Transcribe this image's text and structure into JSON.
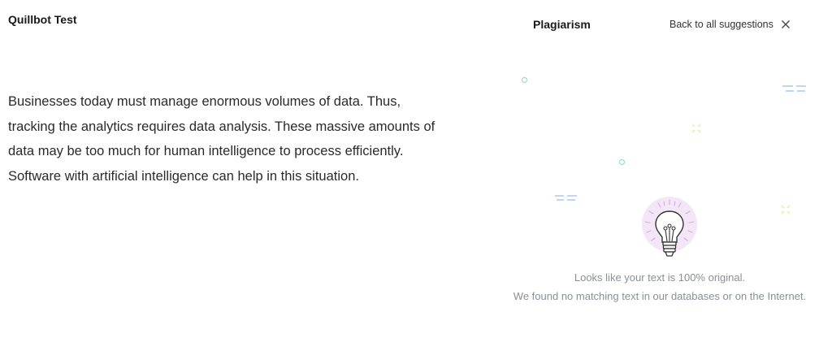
{
  "document": {
    "title": "Quillbot Test",
    "lines": [
      "Businesses today must manage enormous volumes of data. Thus,",
      "tracking the analytics requires data analysis. These massive amounts of",
      "data may be too much for human intelligence to process efficiently.",
      "Software with artificial intelligence can help in this situation."
    ]
  },
  "panel": {
    "title": "Plagiarism",
    "back_label": "Back to all suggestions",
    "close_icon": "close-icon",
    "result_icon": "lightbulb-icon",
    "message_primary": "Looks like your text is 100% original.",
    "message_secondary": "We found no matching text in our databases or on the Internet."
  },
  "colors": {
    "accent_teal": "#8fd3c8",
    "accent_blue": "#a9c8ee",
    "accent_yellow": "#f3e6a2",
    "bulb_glow": "#f1e3f7",
    "muted_text": "#8a8f98"
  }
}
